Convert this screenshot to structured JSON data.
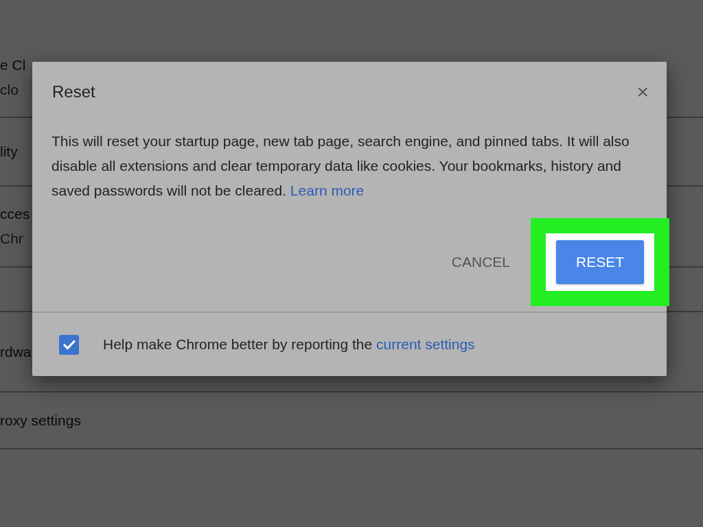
{
  "background_rows": [
    {
      "lines": [
        "e Cl",
        "clo"
      ]
    },
    {
      "lines": [
        "lity"
      ]
    },
    {
      "lines": [
        "cces",
        "Chr"
      ]
    },
    {
      "lines": []
    },
    {
      "lines": [
        "rdwa"
      ]
    },
    {
      "lines": [
        "roxy settings"
      ]
    }
  ],
  "dialog": {
    "title": "Reset",
    "close": "×",
    "body": "This will reset your startup page, new tab page, search engine, and pinned tabs. It will also disable all extensions and clear temporary data like cookies. Your bookmarks, history and saved passwords will not be cleared.",
    "learn_more": "Learn more",
    "cancel": "CANCEL",
    "reset": "RESET",
    "checkbox": {
      "checked": true,
      "label": "Help make Chrome better by reporting the",
      "link": "current settings"
    }
  }
}
